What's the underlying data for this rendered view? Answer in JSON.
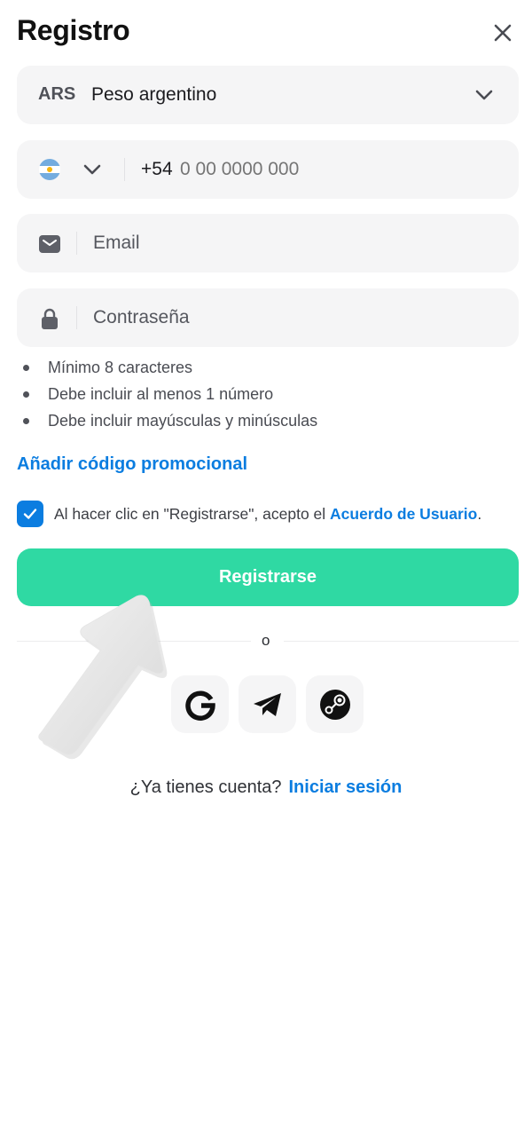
{
  "header": {
    "title": "Registro",
    "close_icon": "close-icon"
  },
  "currency": {
    "code": "ARS",
    "name": "Peso argentino",
    "icon": "chevron-down-icon"
  },
  "phone": {
    "flag_icon": "argentina-flag-icon",
    "prefix": "+54",
    "placeholder": "0 00 0000 000"
  },
  "email": {
    "placeholder": "Email",
    "icon": "envelope-icon"
  },
  "password": {
    "placeholder": "Contraseña",
    "icon": "lock-icon"
  },
  "password_rules": [
    "Mínimo 8 caracteres",
    "Debe incluir al menos 1 número",
    "Debe incluir mayúsculas y minúsculas"
  ],
  "promo_link": "Añadir código promocional",
  "agreement": {
    "checked": true,
    "text": "Al hacer clic en \"Registrarse\", acepto el ",
    "link": "Acuerdo de Usuario",
    "suffix": "."
  },
  "submit_label": "Registrarse",
  "divider_text": "o",
  "social": [
    {
      "name": "google",
      "icon": "google-icon"
    },
    {
      "name": "telegram",
      "icon": "telegram-icon"
    },
    {
      "name": "steam",
      "icon": "steam-icon"
    }
  ],
  "login": {
    "question": "¿Ya tienes cuenta?",
    "link": "Iniciar sesión"
  },
  "colors": {
    "accent": "#0b7de0",
    "primary_button": "#2fd9a3",
    "field_bg": "#f5f5f6"
  }
}
